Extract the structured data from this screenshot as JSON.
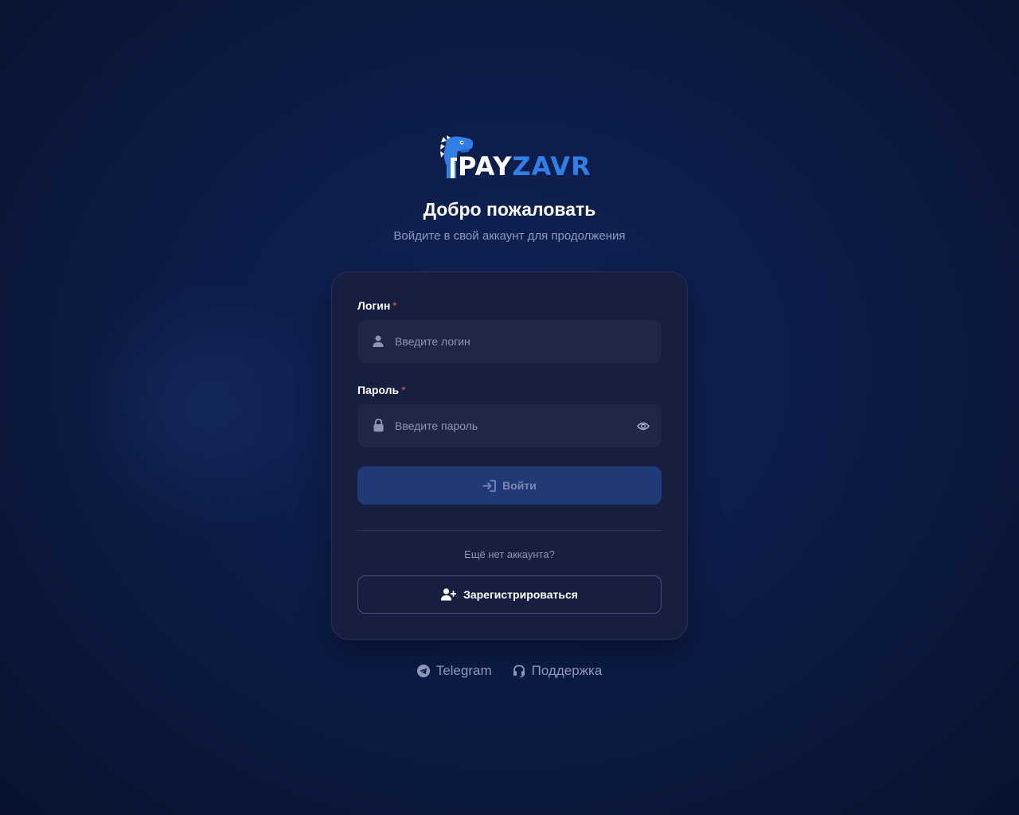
{
  "brand": {
    "name_part1": "PAY",
    "name_part2": "ZAVR",
    "accent": "#2f7fe6",
    "logo_icon": "dino-icon"
  },
  "header": {
    "title": "Добро пожаловать",
    "subtitle": "Войдите в свой аккаунт для продолжения"
  },
  "form": {
    "login": {
      "label": "Логин",
      "required_mark": "*",
      "placeholder": "Введите логин",
      "value": "",
      "icon": "user-icon"
    },
    "password": {
      "label": "Пароль",
      "required_mark": "*",
      "placeholder": "Введите пароль",
      "value": "",
      "icon": "lock-icon",
      "toggle_icon": "eye-icon"
    },
    "submit_label": "Войти",
    "submit_icon": "sign-in-icon",
    "no_account_text": "Ещё нет аккаунта?",
    "register_label": "Зарегистрироваться",
    "register_icon": "user-plus-icon"
  },
  "footer": {
    "links": [
      {
        "label": "Telegram",
        "icon": "telegram-icon"
      },
      {
        "label": "Поддержка",
        "icon": "headset-icon"
      }
    ]
  }
}
